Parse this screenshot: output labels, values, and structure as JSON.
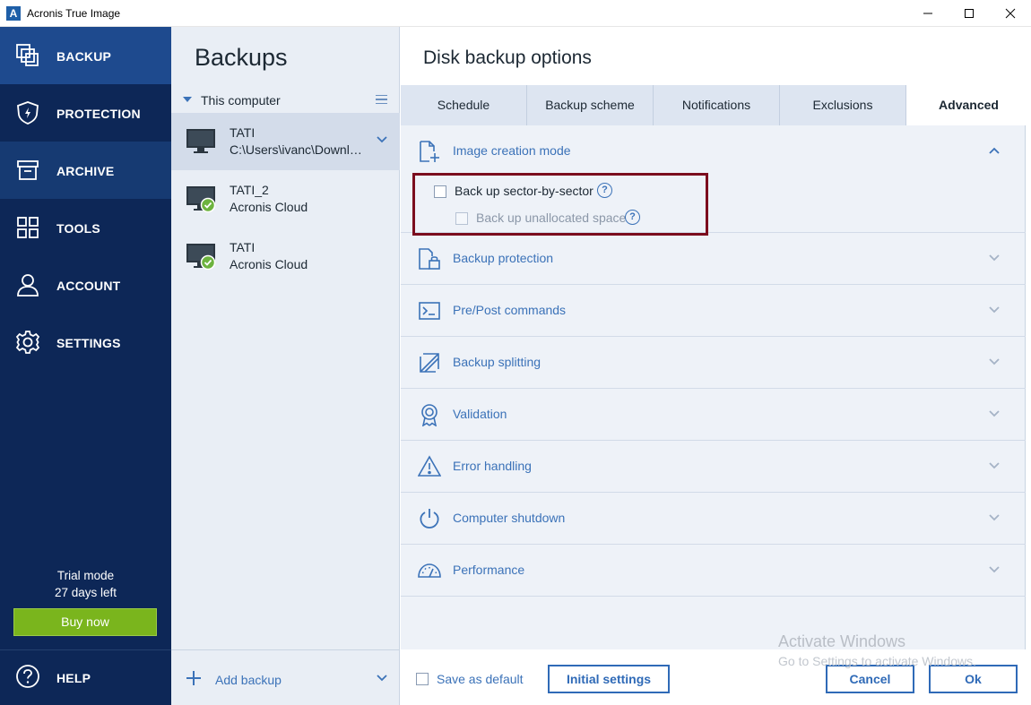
{
  "window": {
    "title": "Acronis True Image",
    "logo_letter": "A"
  },
  "nav": {
    "items": [
      {
        "label": "BACKUP",
        "icon": "backup-icon",
        "active": true
      },
      {
        "label": "PROTECTION",
        "icon": "shield-icon"
      },
      {
        "label": "ARCHIVE",
        "icon": "archive-icon"
      },
      {
        "label": "TOOLS",
        "icon": "tools-grid-icon"
      },
      {
        "label": "ACCOUNT",
        "icon": "user-icon"
      },
      {
        "label": "SETTINGS",
        "icon": "gear-icon"
      }
    ],
    "trial_line1": "Trial mode",
    "trial_line2": "27 days left",
    "buy_label": "Buy now",
    "help_label": "HELP"
  },
  "backups": {
    "title": "Backups",
    "group_label": "This computer",
    "items": [
      {
        "name": "TATI",
        "sub": "C:\\Users\\ivanc\\Downloads",
        "selected": true,
        "status": "none"
      },
      {
        "name": "TATI_2",
        "sub": "Acronis Cloud",
        "status": "ok"
      },
      {
        "name": "TATI",
        "sub": "Acronis Cloud",
        "status": "ok"
      }
    ],
    "add_label": "Add backup"
  },
  "main": {
    "title": "Disk backup options",
    "tabs": [
      "Schedule",
      "Backup scheme",
      "Notifications",
      "Exclusions",
      "Advanced"
    ],
    "active_tab": "Advanced",
    "sections": [
      {
        "label": "Image creation mode",
        "icon": "new-file-icon",
        "expanded": true
      },
      {
        "label": "Backup protection",
        "icon": "lock-file-icon"
      },
      {
        "label": "Pre/Post commands",
        "icon": "terminal-icon"
      },
      {
        "label": "Backup splitting",
        "icon": "split-icon"
      },
      {
        "label": "Validation",
        "icon": "badge-icon"
      },
      {
        "label": "Error handling",
        "icon": "warning-icon"
      },
      {
        "label": "Computer shutdown",
        "icon": "power-icon"
      },
      {
        "label": "Performance",
        "icon": "gauge-icon"
      }
    ],
    "options": {
      "sector_by_sector": "Back up sector-by-sector",
      "unallocated": "Back up unallocated space"
    },
    "help_glyph": "?",
    "save_default": "Save as default",
    "initial_settings": "Initial settings",
    "cancel": "Cancel",
    "ok": "Ok"
  },
  "watermark": {
    "line1": "Activate Windows",
    "line2": "Go to Settings to activate Windows."
  },
  "colors": {
    "nav_bg": "#0d2757",
    "nav_active": "#1e4a8e",
    "accent": "#3b72b8",
    "buy_green": "#7ab51d",
    "highlight_border": "#7b0d1e"
  }
}
